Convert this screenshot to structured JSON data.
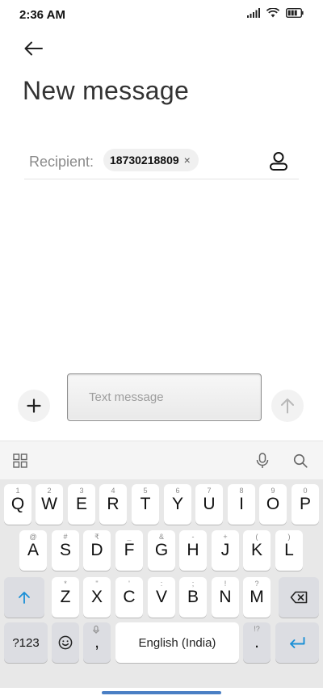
{
  "status": {
    "time": "2:36 AM"
  },
  "header": {
    "title": "New message"
  },
  "recipient": {
    "label": "Recipient:",
    "chip": "18730218809",
    "chip_close": "×"
  },
  "compose": {
    "placeholder": "Text message"
  },
  "keyboard": {
    "row1": [
      {
        "main": "Q",
        "sub": "1"
      },
      {
        "main": "W",
        "sub": "2"
      },
      {
        "main": "E",
        "sub": "3"
      },
      {
        "main": "R",
        "sub": "4"
      },
      {
        "main": "T",
        "sub": "5"
      },
      {
        "main": "Y",
        "sub": "6"
      },
      {
        "main": "U",
        "sub": "7"
      },
      {
        "main": "I",
        "sub": "8"
      },
      {
        "main": "O",
        "sub": "9"
      },
      {
        "main": "P",
        "sub": "0"
      }
    ],
    "row2": [
      {
        "main": "A",
        "sub": "@"
      },
      {
        "main": "S",
        "sub": "#"
      },
      {
        "main": "D",
        "sub": "₹"
      },
      {
        "main": "F",
        "sub": "_"
      },
      {
        "main": "G",
        "sub": "&"
      },
      {
        "main": "H",
        "sub": "-"
      },
      {
        "main": "J",
        "sub": "+"
      },
      {
        "main": "K",
        "sub": "("
      },
      {
        "main": "L",
        "sub": ")"
      }
    ],
    "row3": [
      {
        "main": "Z",
        "sub": "*"
      },
      {
        "main": "X",
        "sub": "\""
      },
      {
        "main": "C",
        "sub": "'"
      },
      {
        "main": "V",
        "sub": ":"
      },
      {
        "main": "B",
        "sub": ";"
      },
      {
        "main": "N",
        "sub": "!"
      },
      {
        "main": "M",
        "sub": "?"
      }
    ],
    "row4": {
      "symbols": "?123",
      "comma": ",",
      "space": "English (India)",
      "period": ".",
      "period_sub": "!?"
    }
  },
  "colors": {
    "accent": "#1a8fd6",
    "nav_handle": "#4a7fc4"
  }
}
